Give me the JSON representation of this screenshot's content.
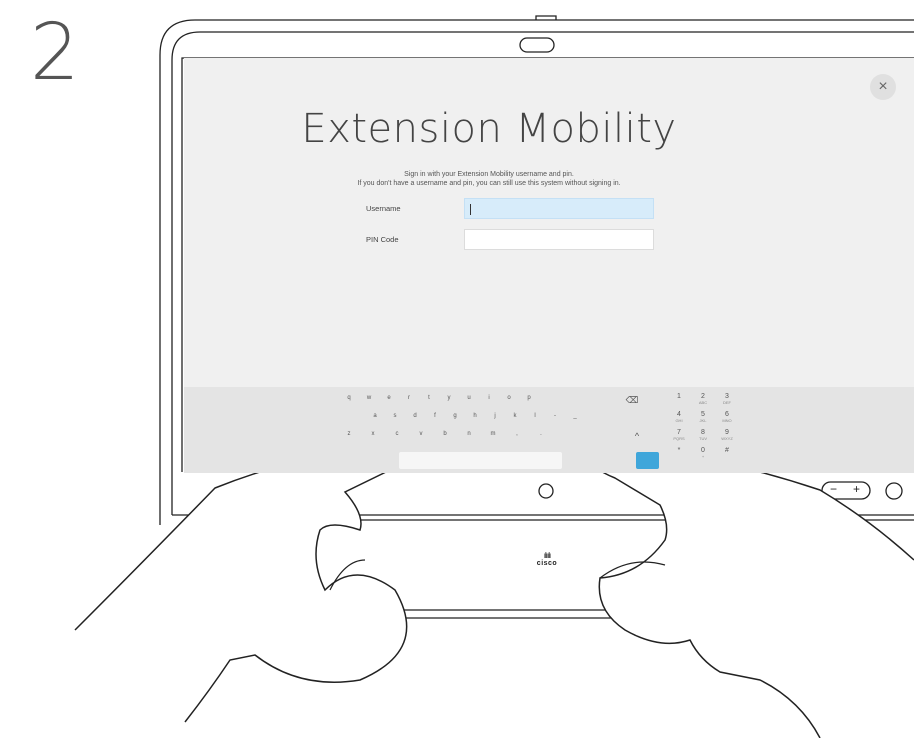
{
  "step_number": "2",
  "screen": {
    "title": "Extension Mobility",
    "subtitle_line1": "Sign in with your Extension Mobility username and pin.",
    "subtitle_line2": "If you don't have a username and pin, you can still use this system without signing in.",
    "fields": [
      {
        "label": "Username",
        "value": ""
      },
      {
        "label": "PIN Code",
        "value": ""
      }
    ],
    "close_symbol": "×"
  },
  "keyboard": {
    "row1": [
      "q",
      "w",
      "e",
      "r",
      "t",
      "y",
      "u",
      "i",
      "o",
      "p"
    ],
    "row2": [
      "a",
      "s",
      "d",
      "f",
      "g",
      "h",
      "j",
      "k",
      "l",
      "-",
      "_"
    ],
    "row3": [
      "z",
      "x",
      "c",
      "v",
      "b",
      "n",
      "m",
      ",",
      "."
    ],
    "backspace_icon": "⌫",
    "shift_icon": "^",
    "numpad": [
      {
        "n": "1",
        "l": ""
      },
      {
        "n": "2",
        "l": "ABC"
      },
      {
        "n": "3",
        "l": "DEF"
      },
      {
        "n": "4",
        "l": "GHI"
      },
      {
        "n": "5",
        "l": "JKL"
      },
      {
        "n": "6",
        "l": "MNO"
      },
      {
        "n": "7",
        "l": "PQRS"
      },
      {
        "n": "8",
        "l": "TUV"
      },
      {
        "n": "9",
        "l": "WXYZ"
      },
      {
        "n": "*",
        "l": ""
      },
      {
        "n": "0",
        "l": "+"
      },
      {
        "n": "#",
        "l": ""
      }
    ]
  },
  "device": {
    "brand_bars": "ılıılı",
    "brand_name": "cisco",
    "volume_minus": "−",
    "volume_plus": "+"
  }
}
